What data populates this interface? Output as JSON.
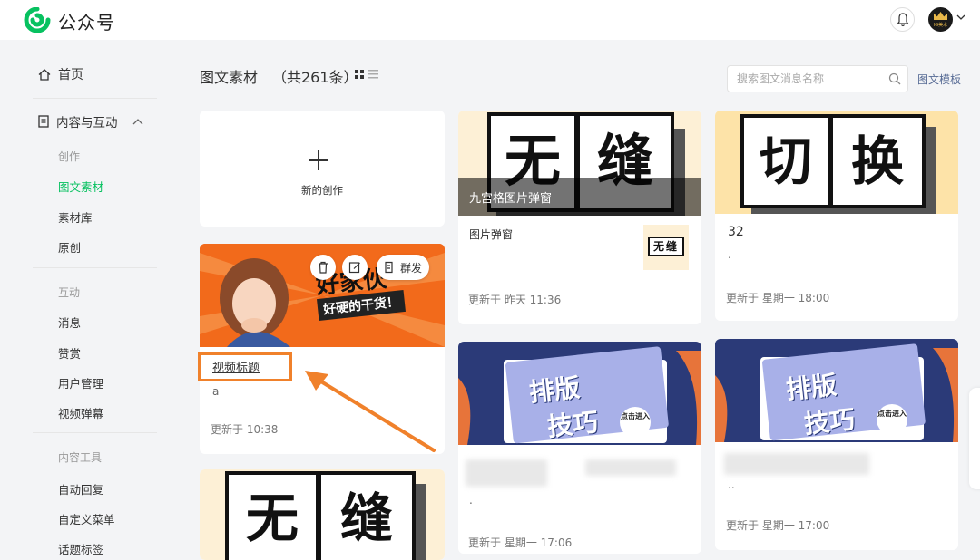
{
  "app": {
    "brand": "公众号",
    "avatar_text": "IG美术"
  },
  "sidebar": {
    "home": "首页",
    "group": "内容与互动",
    "sections": {
      "create": "创作",
      "interact": "互动",
      "tools": "内容工具"
    },
    "create_items": [
      "图文素材",
      "素材库",
      "原创"
    ],
    "interact_items": [
      "消息",
      "赞赏",
      "用户管理",
      "视频弹幕"
    ],
    "tool_items": [
      "自动回复",
      "自定义菜单",
      "话题标签"
    ]
  },
  "header": {
    "title": "图文素材",
    "count": "（共261条）",
    "search_placeholder": "搜索图文消息名称",
    "template_link": "图文模板"
  },
  "new_card": {
    "label": "新的创作"
  },
  "cards": [
    {
      "cover_text": [
        "好家伙",
        "好硬的干货！"
      ],
      "title": "视频标题",
      "subtitle": "a",
      "time": "更新于 10:38",
      "actions": {
        "publish": "群发"
      }
    },
    {
      "cover_chars": [
        "无",
        "缝"
      ],
      "overlay": "九宫格图片弹窗",
      "title": "图片弹窗",
      "thumb_chars": [
        "无",
        "缝"
      ],
      "time": "更新于 昨天 11:36"
    },
    {
      "cover_chars": [
        "切",
        "换"
      ],
      "title": "32",
      "subtitle": ".",
      "time": "更新于 星期一 18:00"
    },
    {
      "cover_chars": [
        "排版",
        "技巧"
      ],
      "badge": "点击进入",
      "subtitle": ".",
      "time": "更新于 星期一 17:06"
    },
    {
      "cover_chars": [
        "排版",
        "技巧"
      ],
      "badge": "点击进入",
      "subtitle": "..",
      "time": "更新于 星期一 17:00"
    },
    {
      "cover_chars": [
        "无",
        "缝"
      ]
    }
  ],
  "colors": {
    "accent": "#07c160",
    "highlight": "#f0812b",
    "link": "#576b95",
    "orange_cover": "#f26a1b",
    "cream_cover": "#fdf0d6",
    "navy_cover": "#2b3a78"
  }
}
